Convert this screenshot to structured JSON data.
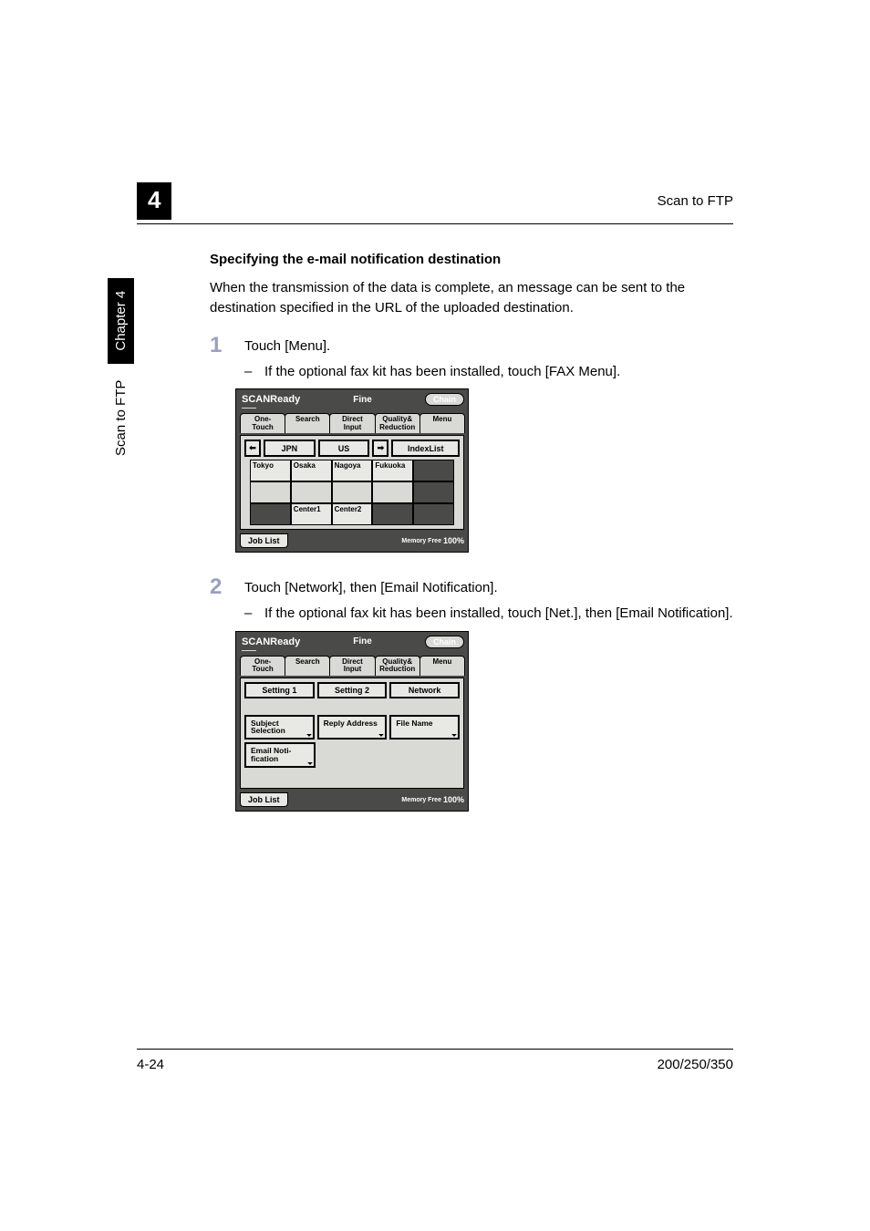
{
  "header": {
    "chapter_num": "4",
    "running_title": "Scan to FTP"
  },
  "sidebar": {
    "section": "Scan to FTP",
    "chapter_label": "Chapter 4"
  },
  "section": {
    "title": "Specifying the e-mail notification destination",
    "intro": "When the transmission of the data is complete, an message can be sent to the destination specified in the URL of the uploaded destination."
  },
  "steps": [
    {
      "num": "1",
      "text": "Touch [Menu].",
      "sub": "If the optional fax kit has been installed, touch [FAX Menu]."
    },
    {
      "num": "2",
      "text": "Touch [Network], then [Email Notification].",
      "sub": "If the optional fax kit has been installed, touch [Net.], then [Email Notification]."
    }
  ],
  "lcd_common": {
    "ready": "SCANReady",
    "fine": "Fine",
    "chain": "Chain",
    "tabs": {
      "one_touch": "One-Touch",
      "search": "Search",
      "direct_input": "Direct\nInput",
      "quality": "Quality&\nReduction",
      "menu": "Menu"
    },
    "job_list": "Job List",
    "memory_label": "Memory\nFree",
    "memory_value": "100%"
  },
  "lcd1": {
    "left_arrow": "⬅",
    "right_arrow": "➡",
    "jpn": "JPN",
    "us": "US",
    "index_list": "IndexList",
    "grid": [
      [
        "Tokyo",
        "Osaka",
        "Nagoya",
        "Fukuoka",
        ""
      ],
      [
        "",
        "",
        "",
        "",
        ""
      ],
      [
        "",
        "Center1",
        "Center2",
        "",
        ""
      ]
    ]
  },
  "lcd2": {
    "tabs_body": {
      "setting1": "Setting 1",
      "setting2": "Setting 2",
      "network": "Network"
    },
    "buttons": {
      "subject": "Subject\nSelection",
      "reply": "Reply\nAddress",
      "file_name": "File Name",
      "email_notif": "Email Noti-\nfication"
    }
  },
  "footer": {
    "page": "4-24",
    "model": "200/250/350"
  }
}
